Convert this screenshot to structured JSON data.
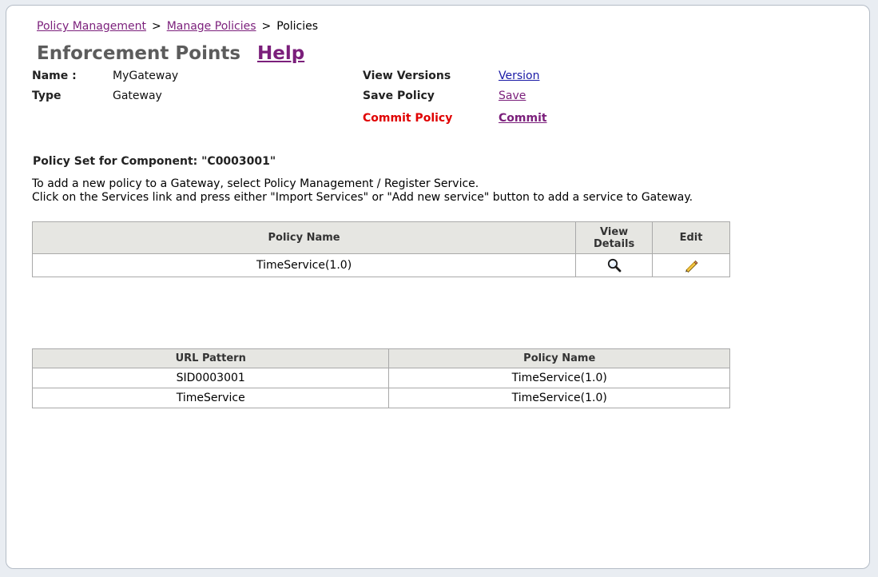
{
  "breadcrumb": {
    "item1": "Policy Management",
    "item2": "Manage Policies",
    "current": "Policies",
    "separator": ">"
  },
  "header": {
    "title": "Enforcement Points",
    "help": "Help"
  },
  "info": {
    "name_label": "Name :",
    "name_value": "MyGateway",
    "type_label": "Type",
    "type_value": "Gateway"
  },
  "actions": {
    "view_versions_label": "View Versions",
    "view_versions_link": "Version",
    "save_policy_label": "Save Policy",
    "save_policy_link": "Save",
    "commit_policy_label": "Commit Policy",
    "commit_policy_link": "Commit"
  },
  "policy_set": {
    "heading": "Policy Set for Component: \"C0003001\"",
    "instruction_1": "To add a new policy to a Gateway, select Policy Management / Register Service.",
    "instruction_2": "Click on the Services link and press either \"Import Services\" or \"Add new service\" button to add a service to Gateway."
  },
  "policy_table": {
    "headers": [
      "Policy Name",
      "View Details",
      "Edit"
    ],
    "rows": [
      {
        "policy_name": "TimeService(1.0)",
        "view_icon": "magnifier-icon",
        "edit_icon": "pencil-icon"
      }
    ]
  },
  "url_table": {
    "headers": [
      "URL Pattern",
      "Policy Name"
    ],
    "rows": [
      {
        "url_pattern": "SID0003001",
        "policy_name": "TimeService(1.0)"
      },
      {
        "url_pattern": "TimeService",
        "policy_name": "TimeService(1.0)"
      }
    ]
  },
  "colors": {
    "link": "#7b1f7b",
    "link_blue": "#1a1aa6",
    "commit_label": "#e00000",
    "table_header_bg": "#e6e6e2",
    "page_bg": "#e9edf2"
  }
}
